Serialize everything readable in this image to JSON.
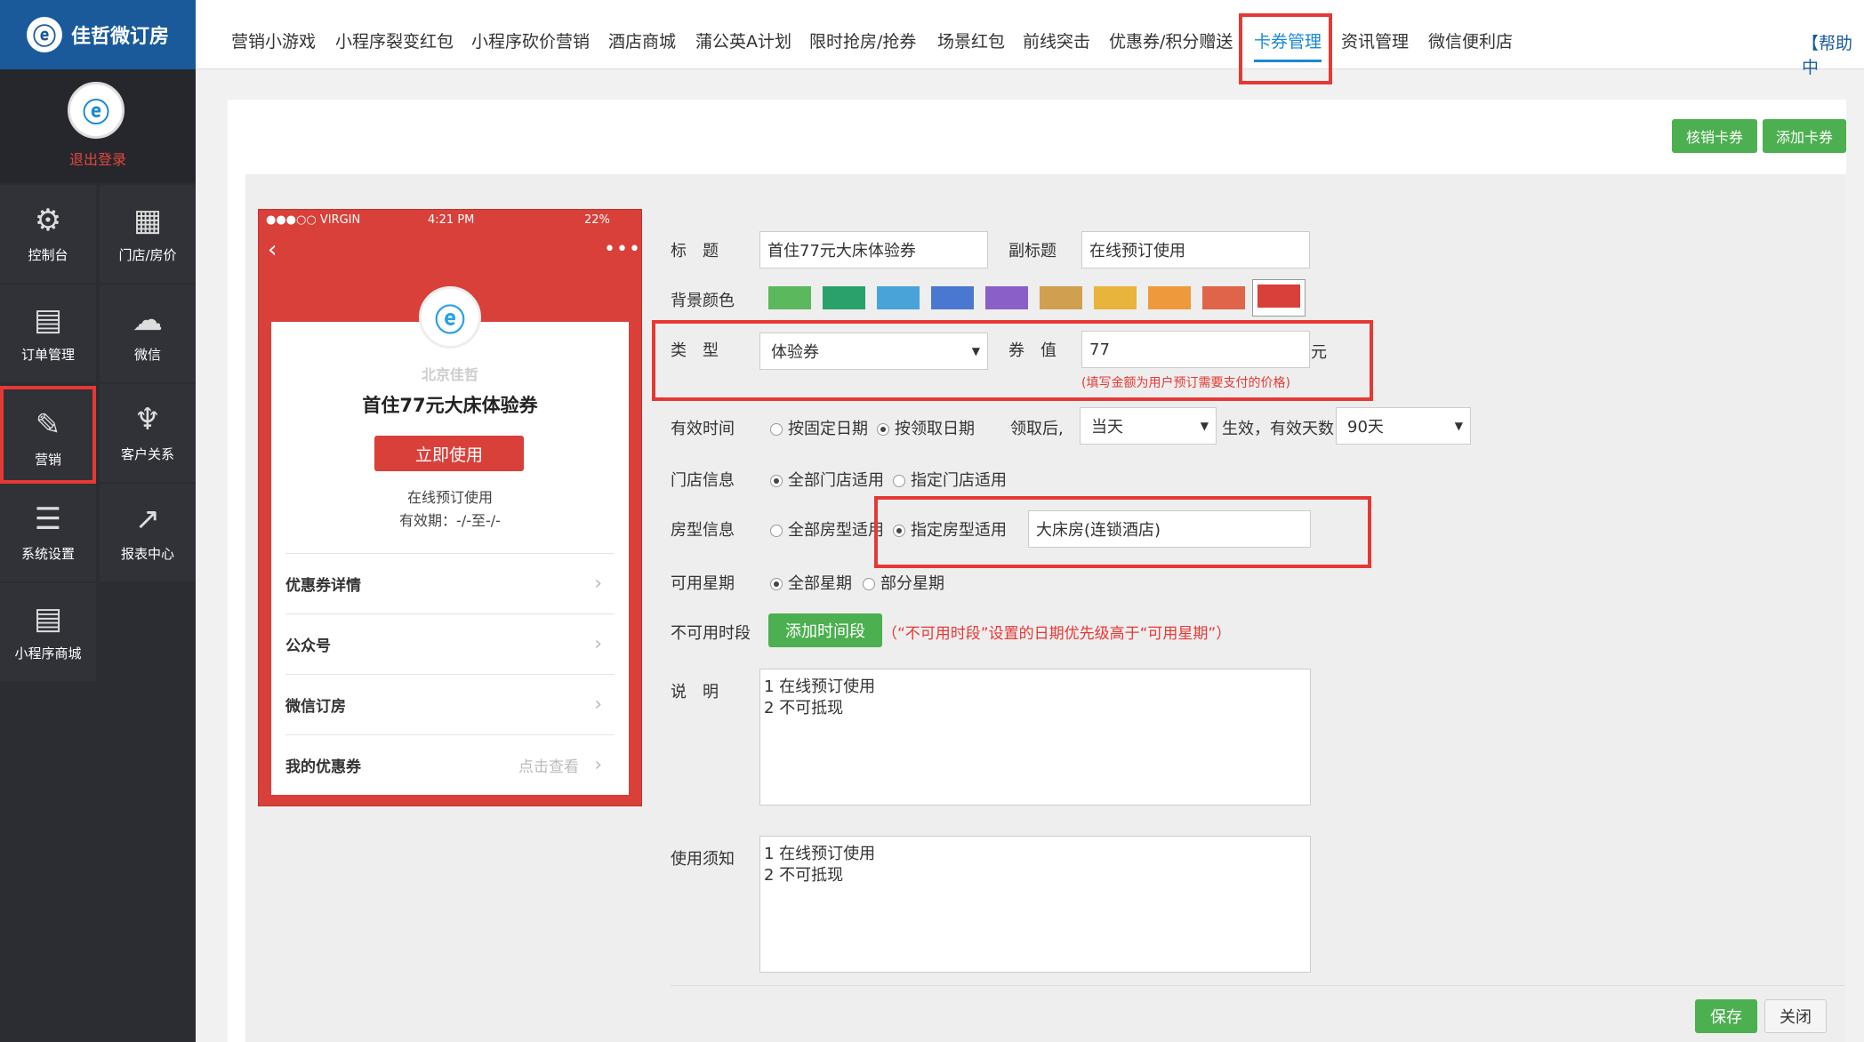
{
  "app": {
    "logo_text": "佳哲微订房",
    "logout": "退出登录"
  },
  "sidebar": {
    "items": [
      {
        "label": "控制台",
        "icon": "gear-icon"
      },
      {
        "label": "门店/房价",
        "icon": "building-icon"
      },
      {
        "label": "订单管理",
        "icon": "document-icon"
      },
      {
        "label": "微信",
        "icon": "wechat-icon"
      },
      {
        "label": "营销",
        "icon": "sale-tag-icon",
        "active": true
      },
      {
        "label": "客户关系",
        "icon": "glasses-icon"
      },
      {
        "label": "系统设置",
        "icon": "sliders-icon"
      },
      {
        "label": "报表中心",
        "icon": "chart-line-icon"
      },
      {
        "label": "小程序商城",
        "icon": "document-icon"
      }
    ]
  },
  "topmenu": {
    "items": [
      "营销小游戏",
      "小程序裂变红包",
      "小程序砍价营销",
      "酒店商城",
      "蒲公英A计划",
      "限时抢房/抢券",
      "场景红包",
      "前线突击",
      "优惠券/积分赠送",
      "卡券管理",
      "资讯管理",
      "微信便利店"
    ],
    "active": "卡券管理",
    "help": "【帮助中"
  },
  "actions": {
    "verify": "核销卡券",
    "add": "添加卡券"
  },
  "preview": {
    "carrier": "●●●○○ VIRGIN",
    "time": "4:21 PM",
    "battery": "22%",
    "shop": "北京佳哲",
    "title": "首住77元大床体验券",
    "use_button": "立即使用",
    "subtitle": "在线预订使用",
    "validity": "有效期：-/-至-/-",
    "list": [
      {
        "label": "优惠券详情",
        "hint": ""
      },
      {
        "label": "公众号",
        "hint": ""
      },
      {
        "label": "微信订房",
        "hint": ""
      },
      {
        "label": "我的优惠券",
        "hint": "点击查看"
      }
    ]
  },
  "form": {
    "title_label": "标　题",
    "title_value": "首住77元大床体验券",
    "subtitle_label": "副标题",
    "subtitle_value": "在线预订使用",
    "bg_label": "背景颜色",
    "colors": [
      "#5cb85c",
      "#2aa06b",
      "#4aa3d8",
      "#4a78d0",
      "#8a5fc8",
      "#d0a050",
      "#e8b43c",
      "#ee9a3c",
      "#e0644a",
      "#d9403a"
    ],
    "type_label": "类　型",
    "type_value": "体验券",
    "value_label": "券　值",
    "value_value": "77",
    "value_unit": "元",
    "value_hint": "(填写金额为用户预订需要支付的价格)",
    "validity_label": "有效时间",
    "validity_fixed": "按固定日期",
    "validity_claim": "按领取日期",
    "after_claim": "领取后,",
    "after_claim_value": "当天",
    "effective": "生效，有效天数",
    "days_value": "90天",
    "store_label": "门店信息",
    "store_all": "全部门店适用",
    "store_some": "指定门店适用",
    "room_label": "房型信息",
    "room_all": "全部房型适用",
    "room_some": "指定房型适用",
    "room_value": "大床房(连锁酒店)",
    "week_label": "可用星期",
    "week_all": "全部星期",
    "week_some": "部分星期",
    "unavail_label": "不可用时段",
    "add_period": "添加时间段",
    "unavail_hint": "（“不可用时段”设置的日期优先级高于“可用星期”）",
    "desc_label": "说　明",
    "desc_value": "1 在线预订使用\n2 不可抵现",
    "notice_label": "使用须知",
    "notice_value": "1 在线预订使用\n2 不可抵现",
    "save": "保存",
    "close": "关闭"
  }
}
